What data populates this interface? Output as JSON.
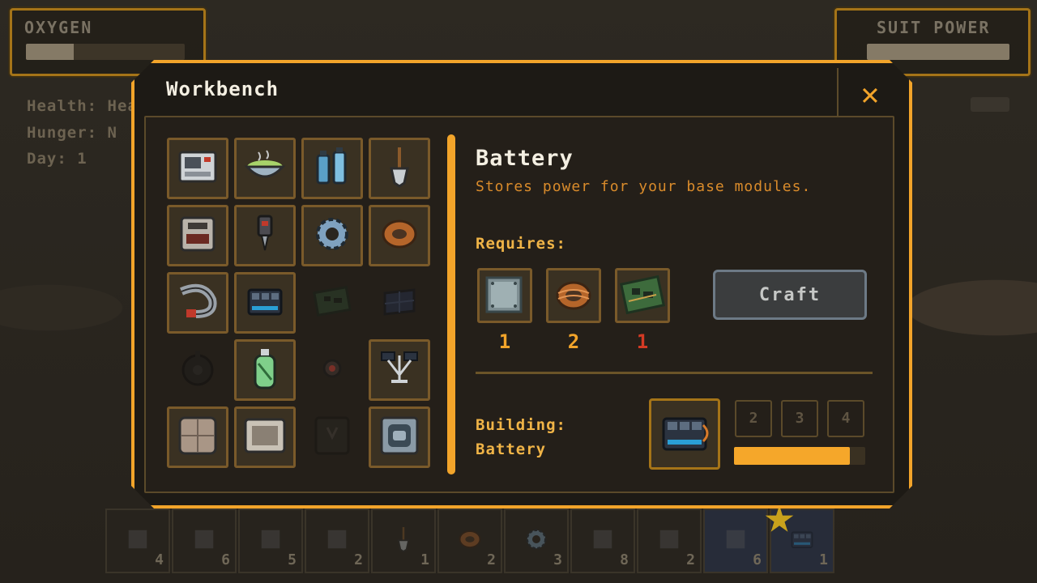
{
  "hud": {
    "oxygen_label": "OXYGEN",
    "oxygen_level": 0.3,
    "suit_power_label": "SUIT POWER",
    "suit_power_level": 1.0,
    "stats": [
      "Health: Healthy",
      "Hunger: N",
      "Day: 1"
    ]
  },
  "workbench": {
    "title": "Workbench",
    "close_label": "✕",
    "recipes": [
      {
        "name": "computer",
        "available": true
      },
      {
        "name": "food-bowl",
        "available": true
      },
      {
        "name": "water-bottles",
        "available": true
      },
      {
        "name": "shovel",
        "available": true
      },
      {
        "name": "machine",
        "available": true
      },
      {
        "name": "drill",
        "available": true
      },
      {
        "name": "gear",
        "available": true
      },
      {
        "name": "copper-wire",
        "available": true
      },
      {
        "name": "hose",
        "available": true
      },
      {
        "name": "battery",
        "available": true
      },
      {
        "name": "circuit-board",
        "available": false
      },
      {
        "name": "solar-panel",
        "available": false
      },
      {
        "name": "landmine",
        "available": false
      },
      {
        "name": "oxygen-tank",
        "available": true
      },
      {
        "name": "red-light",
        "available": false
      },
      {
        "name": "antenna",
        "available": true
      },
      {
        "name": "floor-tile",
        "available": true
      },
      {
        "name": "wall-panel",
        "available": true
      },
      {
        "name": "door",
        "available": false
      },
      {
        "name": "airlock",
        "available": true
      }
    ]
  },
  "detail": {
    "name": "Battery",
    "description": "Stores power for your base modules.",
    "requires_label": "Requires:",
    "requirements": [
      {
        "name": "metal-plate",
        "count": "1",
        "sufficient": true
      },
      {
        "name": "copper-wire",
        "count": "2",
        "sufficient": true
      },
      {
        "name": "circuit-board",
        "count": "1",
        "sufficient": false
      }
    ],
    "craft_label": "Craft",
    "building_label": "Building:",
    "building_item": "Battery",
    "queue": [
      "2",
      "3",
      "4"
    ],
    "progress": 0.88
  },
  "hotbar": [
    {
      "name": "rocks",
      "count": "4"
    },
    {
      "name": "metal-plate",
      "count": "6"
    },
    {
      "name": "grass",
      "count": "5"
    },
    {
      "name": "anvil",
      "count": "2"
    },
    {
      "name": "shovel",
      "count": "1"
    },
    {
      "name": "copper-wire",
      "count": "2"
    },
    {
      "name": "gear",
      "count": "3"
    },
    {
      "name": "ore",
      "count": "8"
    },
    {
      "name": "seed",
      "count": "2"
    },
    {
      "name": "boulder",
      "count": "6"
    },
    {
      "name": "battery",
      "count": "1"
    }
  ]
}
